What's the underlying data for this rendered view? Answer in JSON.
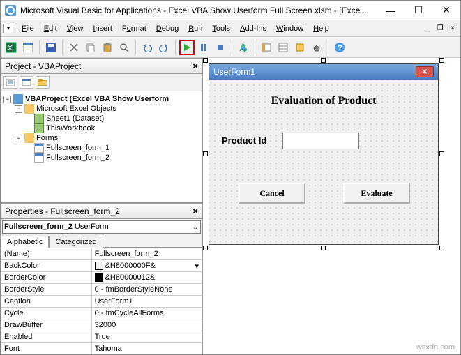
{
  "title": "Microsoft Visual Basic for Applications - Excel VBA Show Userform Full Screen.xlsm - [Exce...",
  "menu": [
    "File",
    "Edit",
    "View",
    "Insert",
    "Format",
    "Debug",
    "Run",
    "Tools",
    "Add-Ins",
    "Window",
    "Help"
  ],
  "project_pane": {
    "title": "Project - VBAProject",
    "root": "VBAProject (Excel VBA Show Userform",
    "folder1": "Microsoft Excel Objects",
    "sheet1": "Sheet1 (Dataset)",
    "thisworkbook": "ThisWorkbook",
    "folder2": "Forms",
    "form1": "Fullscreen_form_1",
    "form2": "Fullscreen_form_2"
  },
  "properties_pane": {
    "title": "Properties - Fullscreen_form_2",
    "combo_name": "Fullscreen_form_2",
    "combo_type": "UserForm",
    "tab1": "Alphabetic",
    "tab2": "Categorized",
    "rows": {
      "name_k": "(Name)",
      "name_v": "Fullscreen_form_2",
      "backcolor_k": "BackColor",
      "backcolor_v": "&H8000000F&",
      "bordercolor_k": "BorderColor",
      "bordercolor_v": "&H80000012&",
      "borderstyle_k": "BorderStyle",
      "borderstyle_v": "0 - fmBorderStyleNone",
      "caption_k": "Caption",
      "caption_v": "UserForm1",
      "cycle_k": "Cycle",
      "cycle_v": "0 - fmCycleAllForms",
      "drawbuffer_k": "DrawBuffer",
      "drawbuffer_v": "32000",
      "enabled_k": "Enabled",
      "enabled_v": "True",
      "font_k": "Font",
      "font_v": "Tahoma"
    }
  },
  "userform": {
    "title": "UserForm1",
    "heading": "Evaluation of Product",
    "label": "Product Id",
    "btn_cancel": "Cancel",
    "btn_evaluate": "Evaluate"
  },
  "watermark": "wsxdn.com"
}
